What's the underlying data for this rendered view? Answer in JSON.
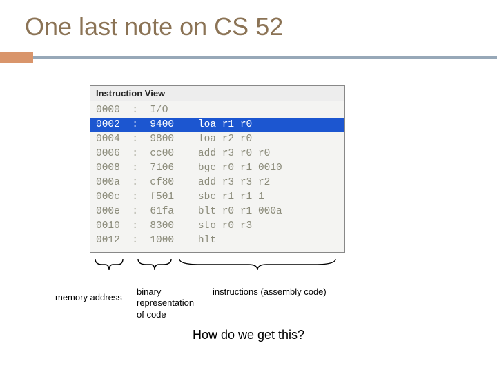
{
  "title": "One last note on CS 52",
  "panel": {
    "header": "Instruction View",
    "rows": [
      {
        "addr": "0000",
        "hex": "I/O",
        "asm": ""
      },
      {
        "addr": "0002",
        "hex": "9400",
        "asm": "loa r1 r0"
      },
      {
        "addr": "0004",
        "hex": "9800",
        "asm": "loa r2 r0"
      },
      {
        "addr": "0006",
        "hex": "cc00",
        "asm": "add r3 r0 r0"
      },
      {
        "addr": "0008",
        "hex": "7106",
        "asm": "bge r0 r1 0010"
      },
      {
        "addr": "000a",
        "hex": "cf80",
        "asm": "add r3 r3 r2"
      },
      {
        "addr": "000c",
        "hex": "f501",
        "asm": "sbc r1 r1 1"
      },
      {
        "addr": "000e",
        "hex": "61fa",
        "asm": "blt r0 r1 000a"
      },
      {
        "addr": "0010",
        "hex": "8300",
        "asm": "sto r0 r3"
      },
      {
        "addr": "0012",
        "hex": "1000",
        "asm": "hlt"
      }
    ],
    "selected_index": 1
  },
  "annotations": {
    "memory_address": "memory address",
    "binary_repr": "binary\nrepresentation\nof code",
    "instructions": "instructions (assembly code)"
  },
  "question": "How do we get this?"
}
